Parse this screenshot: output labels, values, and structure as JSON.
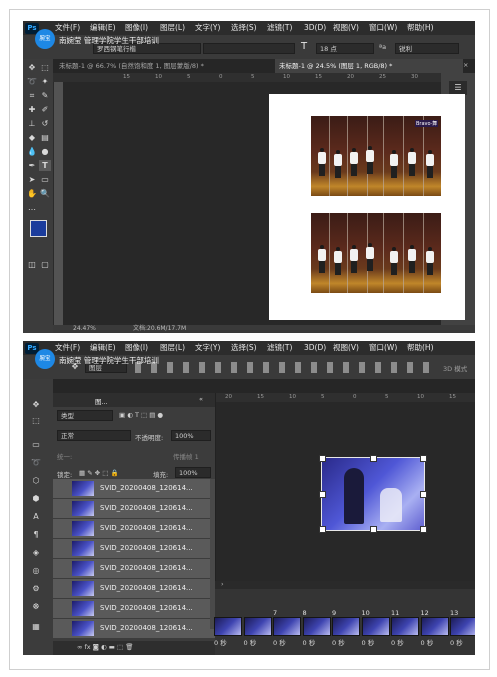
{
  "overlay": {
    "badge": "腕宝",
    "watermark": "南婉莹 管理学院学生干部培训"
  },
  "menu": [
    "文件(F)",
    "编辑(E)",
    "图像(I)",
    "图层(L)",
    "文字(Y)",
    "选择(S)",
    "滤镜(T)",
    "3D(D)",
    "视图(V)",
    "窗口(W)",
    "帮助(H)"
  ],
  "ps_logo": "Ps",
  "shot1": {
    "font_family": "罗西钢笔行楷",
    "font_size": "18 点",
    "aa_mode": "锐利",
    "text_tool_glyph": "T",
    "tabs": [
      "未标题-1 @ 66.7% (自然饱和度 1, 图层蒙版/8) *",
      "未标题-1 @ 24.5% (图层 1, RGB/8) *"
    ],
    "ruler_ticks": [
      "15",
      "10",
      "5",
      "0",
      "5",
      "10",
      "15",
      "20",
      "25",
      "30"
    ],
    "status": {
      "zoom": "24.47%",
      "doc": "文档:20.6M/17.7M"
    },
    "photo_caption": "Bravo·舞"
  },
  "shot2": {
    "toolbar_layer_label": "图层",
    "layers_tab": "图...",
    "filter_label": "类型",
    "blend_mode": "正常",
    "opacity_label": "不透明度:",
    "opacity_value": "100%",
    "propagate_label": "传播帧 1",
    "unify_label": "统一:",
    "lock_label": "锁定:",
    "fill_label": "填充:",
    "fill_value": "100%",
    "layers": [
      "SVID_20200408_120614...",
      "SVID_20200408_120614...",
      "SVID_20200408_120614...",
      "SVID_20200408_120614...",
      "SVID_20200408_120614...",
      "SVID_20200408_120614...",
      "SVID_20200408_120614...",
      "SVID_20200408_120614..."
    ],
    "ruler_ticks": [
      "20",
      "15",
      "10",
      "5",
      "0",
      "5",
      "10",
      "15"
    ],
    "frames": [
      {
        "num": "",
        "delay": "0 秒"
      },
      {
        "num": "",
        "delay": "0 秒"
      },
      {
        "num": "7",
        "delay": "0 秒"
      },
      {
        "num": "8",
        "delay": "0 秒"
      },
      {
        "num": "9",
        "delay": "0 秒"
      },
      {
        "num": "10",
        "delay": "0 秒"
      },
      {
        "num": "11",
        "delay": "0 秒"
      },
      {
        "num": "12",
        "delay": "0 秒"
      },
      {
        "num": "13",
        "delay": "0 秒"
      }
    ],
    "right_label": "3D 模式"
  }
}
